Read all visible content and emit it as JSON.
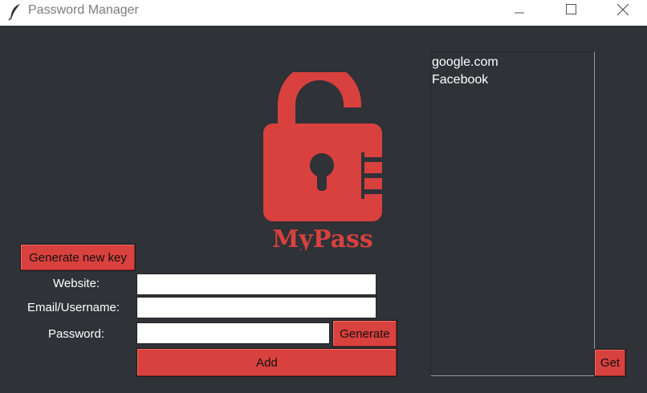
{
  "window": {
    "title": "Password Manager",
    "background": "#2f3237",
    "accent": "#d9413e"
  },
  "titlebar": {
    "app_icon": "feather-icon",
    "controls": [
      "minimize-icon",
      "maximize-icon",
      "close-icon"
    ]
  },
  "logo": {
    "icon": "open-padlock-icon",
    "text": "MyPass"
  },
  "buttons": {
    "generate_key": "Generate new key",
    "generate": "Generate",
    "add": "Add",
    "get": "Get"
  },
  "form": {
    "website_label": "Website:",
    "email_label": "Email/Username:",
    "password_label": "Password:",
    "website_value": "",
    "email_value": "",
    "password_value": ""
  },
  "saved_sites": {
    "items": [
      "google.com",
      "Facebook"
    ]
  }
}
